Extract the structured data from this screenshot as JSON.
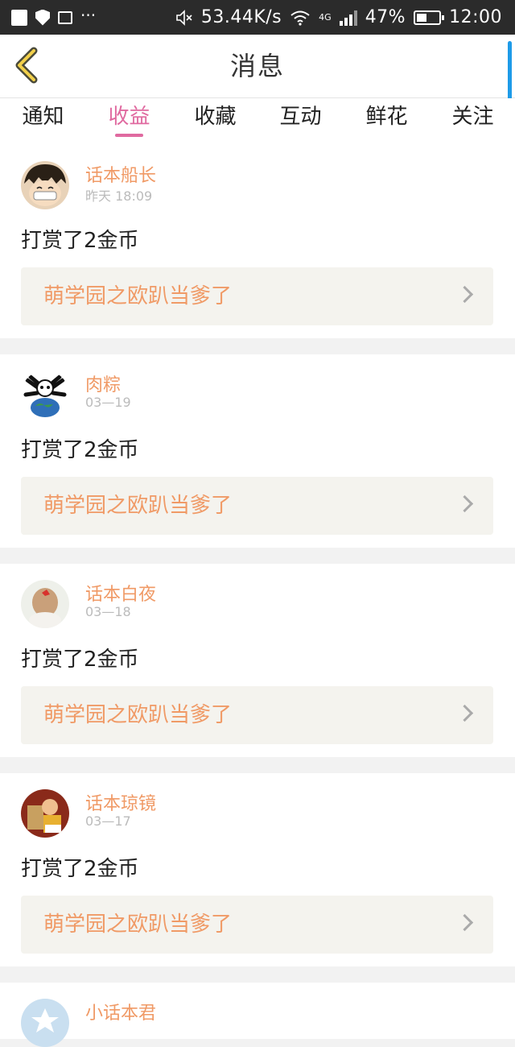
{
  "status_bar": {
    "speed": "53.44K/s",
    "network": "4G",
    "battery_percent": "47%",
    "time": "12:00",
    "battery_level": 0.47
  },
  "header": {
    "title": "消息"
  },
  "tabs": [
    {
      "label": "通知",
      "active": false
    },
    {
      "label": "收益",
      "active": true
    },
    {
      "label": "收藏",
      "active": false
    },
    {
      "label": "互动",
      "active": false
    },
    {
      "label": "鲜花",
      "active": false
    },
    {
      "label": "关注",
      "active": false
    }
  ],
  "messages": [
    {
      "user": "话本船长",
      "time": "昨天 18:09",
      "text": "打赏了2金币",
      "book": "萌学园之欧趴当爹了"
    },
    {
      "user": "肉粽",
      "time": "03—19",
      "text": "打赏了2金币",
      "book": "萌学园之欧趴当爹了"
    },
    {
      "user": "话本白夜",
      "time": "03—18",
      "text": "打赏了2金币",
      "book": "萌学园之欧趴当爹了"
    },
    {
      "user": "话本琼镜",
      "time": "03—17",
      "text": "打赏了2金币",
      "book": "萌学园之欧趴当爹了"
    },
    {
      "user": "小话本君"
    }
  ],
  "colors": {
    "accent": "#e06aa0",
    "orange_text": "#f09a66",
    "status_bar": "#2b2b2b"
  }
}
